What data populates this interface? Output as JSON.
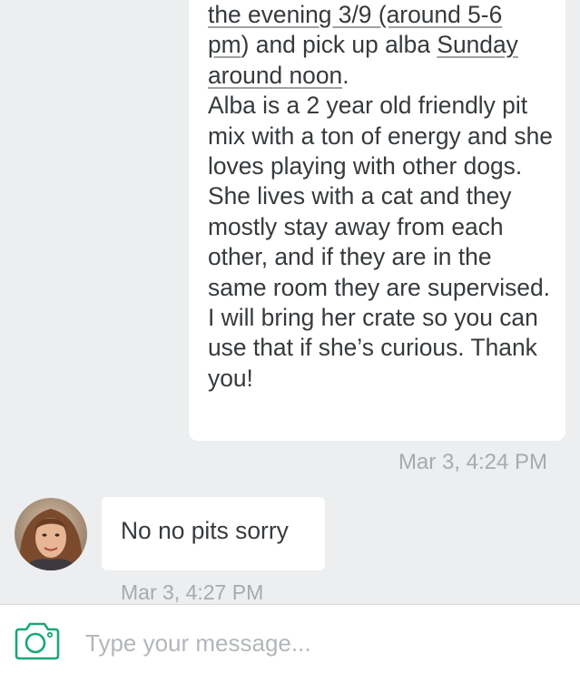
{
  "colors": {
    "background": "#eceeef",
    "bubble": "#ffffff",
    "text": "#363a3d",
    "timestamp": "#a7abae",
    "accent": "#19a974"
  },
  "messages": {
    "outgoing": {
      "line1_a": "the evening 3/9 (around 5-6",
      "line2_a": "pm",
      "line2_b": ") and pick up alba ",
      "line2_c": "Sunday",
      "line3_a": "around noon",
      "line3_b": ".",
      "body": "Alba is a 2 year old friendly pit mix with a ton of energy and she loves playing with other dogs. She lives with a cat and they mostly stay away from each other, and if they are in the same room they are supervised. I will bring her crate so you can use that if she’s curious. Thank you!",
      "timestamp": "Mar 3, 4:24 PM"
    },
    "incoming": {
      "text": "No no pits sorry",
      "timestamp": "Mar 3, 4:27 PM"
    }
  },
  "composer": {
    "placeholder": "Type your message...",
    "value": "",
    "camera_icon": "camera-icon"
  }
}
